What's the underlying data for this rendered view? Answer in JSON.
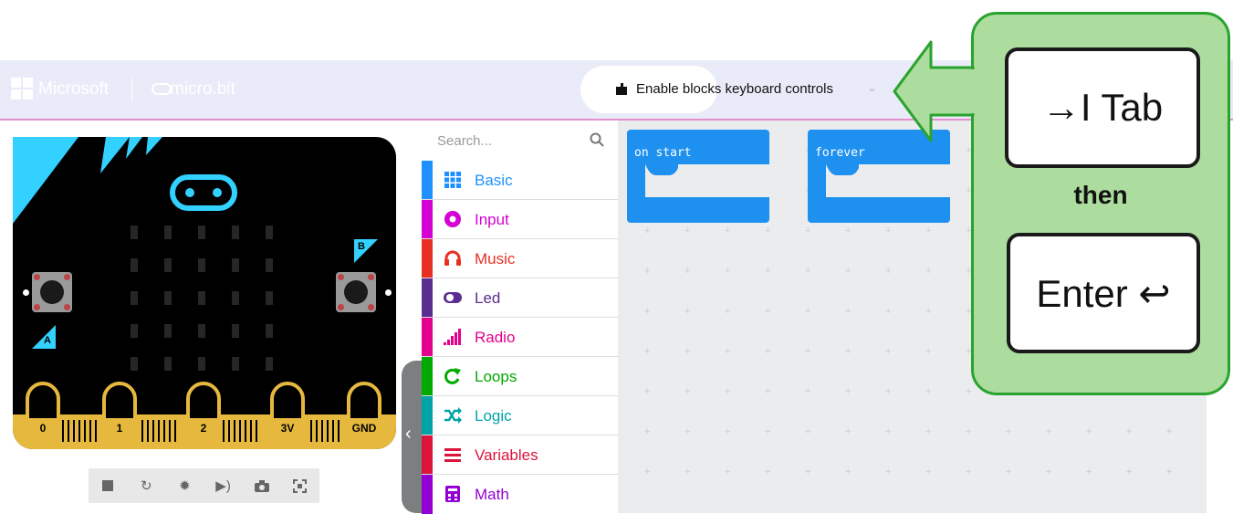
{
  "header": {
    "brand": "Microsoft",
    "product": "micro.bit",
    "keyboard_controls_label": "Enable blocks keyboard controls"
  },
  "simulator": {
    "pins": [
      "0",
      "1",
      "2",
      "3V",
      "GND"
    ],
    "button_a": "A",
    "button_b": "B",
    "toolbar_icons": [
      "stop-icon",
      "restart-icon",
      "debug-icon",
      "mute-icon",
      "screenshot-icon",
      "fullscreen-icon"
    ]
  },
  "toolbox": {
    "search_placeholder": "Search...",
    "categories": [
      {
        "label": "Basic",
        "color": "#1e90ff",
        "icon": "grid-icon"
      },
      {
        "label": "Input",
        "color": "#d400d4",
        "icon": "circle-icon"
      },
      {
        "label": "Music",
        "color": "#e63022",
        "icon": "headphones-icon"
      },
      {
        "label": "Led",
        "color": "#5c2d91",
        "icon": "toggle-icon"
      },
      {
        "label": "Radio",
        "color": "#e3008c",
        "icon": "signal-bars-icon"
      },
      {
        "label": "Loops",
        "color": "#00aa00",
        "icon": "loop-arrow-icon"
      },
      {
        "label": "Logic",
        "color": "#00a4a6",
        "icon": "shuffle-icon"
      },
      {
        "label": "Variables",
        "color": "#dc143c",
        "icon": "lines-icon"
      },
      {
        "label": "Math",
        "color": "#9400d3",
        "icon": "calculator-icon"
      }
    ]
  },
  "workspace": {
    "blocks": [
      {
        "label": "on start"
      },
      {
        "label": "forever"
      }
    ]
  },
  "callout": {
    "first_key": "→I Tab",
    "connector": "then",
    "second_key": "Enter ↩"
  },
  "colors": {
    "header_bg": "#e9ebf8",
    "block_blue": "#1d90f0",
    "callout_green": "#acdc9e",
    "callout_border": "#2aa32e"
  }
}
